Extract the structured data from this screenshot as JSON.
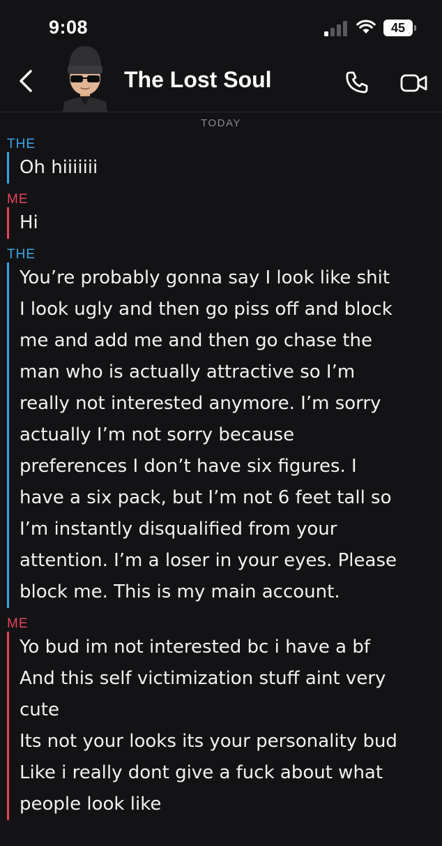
{
  "status_bar": {
    "time": "9:08",
    "battery": "45",
    "icons": [
      "signal-icon",
      "wifi-icon",
      "battery-icon"
    ]
  },
  "header": {
    "title": "The Lost Soul",
    "icons": [
      "back-icon",
      "avatar",
      "phone-icon",
      "video-icon"
    ]
  },
  "day_divider": "TODAY",
  "colors": {
    "background": "#131315",
    "them_accent": "#3aa6e6",
    "me_accent": "#e8445a",
    "text": "#f2f2f2"
  },
  "messages": [
    {
      "sender": "THE",
      "lines": [
        "Oh hiiiiiii"
      ]
    },
    {
      "sender": "ME",
      "lines": [
        "Hi"
      ]
    },
    {
      "sender": "THE",
      "lines": [
        "You’re probably gonna say I look like shit",
        "I look ugly and then go piss off and block",
        "me and add me and then go chase the",
        "man who is actually attractive so I’m",
        "really not interested anymore. I’m sorry",
        "actually I’m not sorry because",
        "preferences I don’t have six figures. I",
        "have a six pack, but I’m not 6 feet tall so",
        "I’m instantly disqualified from your",
        "attention. I’m a loser in your eyes. Please",
        "block me. This is my main account."
      ]
    },
    {
      "sender": "ME",
      "lines": [
        "Yo bud im not interested bc i have a bf",
        "And this self victimization stuff aint very",
        "cute",
        "Its not your looks its your personality bud",
        "Like i really dont give a fuck about what",
        "people look like"
      ]
    }
  ]
}
